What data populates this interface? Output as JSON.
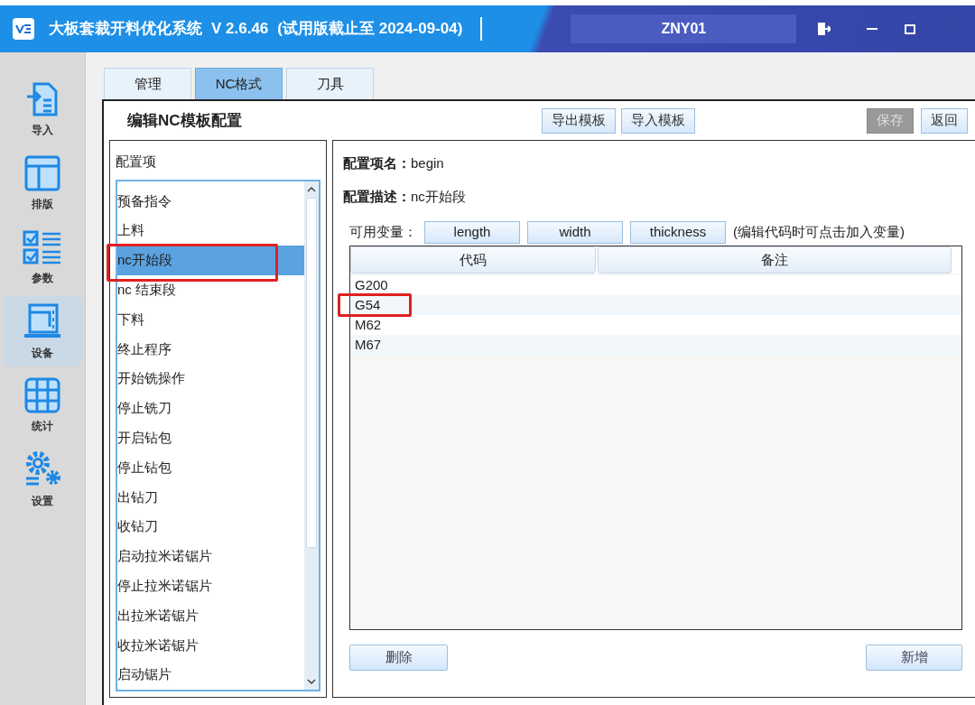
{
  "window": {
    "title": "大板套裁开料优化系统",
    "version": "V 2.6.46",
    "trial": "(试用版截止至 2024-09-04)",
    "user": "ZNY01"
  },
  "sidebar": {
    "items": [
      {
        "label": "导入",
        "selected": false
      },
      {
        "label": "排版",
        "selected": false
      },
      {
        "label": "参数",
        "selected": false
      },
      {
        "label": "设备",
        "selected": true
      },
      {
        "label": "统计",
        "selected": false
      },
      {
        "label": "设置",
        "selected": false
      }
    ]
  },
  "tabs": [
    {
      "label": "管理",
      "selected": false
    },
    {
      "label": "NC格式",
      "selected": true
    },
    {
      "label": "刀具",
      "selected": false
    }
  ],
  "editor": {
    "title": "编辑NC模板配置",
    "buttons": [
      {
        "label": "导出模板",
        "disabled": false
      },
      {
        "label": "导入模板",
        "disabled": false
      },
      {
        "label": "保存",
        "disabled": true
      },
      {
        "label": "返回",
        "disabled": false
      }
    ]
  },
  "config_list": {
    "heading": "配置项",
    "items": [
      {
        "label": "预备指令",
        "selected": false,
        "highlighted": false
      },
      {
        "label": "上料",
        "selected": false,
        "highlighted": false
      },
      {
        "label": "nc开始段",
        "selected": true,
        "highlighted": true
      },
      {
        "label": "nc 结束段",
        "selected": false,
        "highlighted": false
      },
      {
        "label": "下料",
        "selected": false,
        "highlighted": false
      },
      {
        "label": "终止程序",
        "selected": false,
        "highlighted": false
      },
      {
        "label": "开始铣操作",
        "selected": false,
        "highlighted": false
      },
      {
        "label": "停止铣刀",
        "selected": false,
        "highlighted": false
      },
      {
        "label": "开启钻包",
        "selected": false,
        "highlighted": false
      },
      {
        "label": "停止钻包",
        "selected": false,
        "highlighted": false
      },
      {
        "label": "出钻刀",
        "selected": false,
        "highlighted": false
      },
      {
        "label": "收钻刀",
        "selected": false,
        "highlighted": false
      },
      {
        "label": "启动拉米诺锯片",
        "selected": false,
        "highlighted": false
      },
      {
        "label": "停止拉米诺锯片",
        "selected": false,
        "highlighted": false
      },
      {
        "label": "出拉米诺锯片",
        "selected": false,
        "highlighted": false
      },
      {
        "label": "收拉米诺锯片",
        "selected": false,
        "highlighted": false
      },
      {
        "label": "启动锯片",
        "selected": false,
        "highlighted": false
      }
    ]
  },
  "detail": {
    "name_label": "配置项名：",
    "name_value": "begin",
    "desc_label": "配置描述：",
    "desc_value": "nc开始段",
    "variables_label": "可用变量：",
    "variables": [
      "length",
      "width",
      "thickness"
    ],
    "variables_hint": "(编辑代码时可点击加入变量)",
    "table": {
      "columns": [
        "代码",
        "备注"
      ],
      "rows": [
        {
          "code": "G200",
          "highlighted": false
        },
        {
          "code": "G54",
          "highlighted": true
        },
        {
          "code": "M62",
          "highlighted": false
        },
        {
          "code": "M67",
          "highlighted": false
        }
      ]
    },
    "delete_button": "删除",
    "add_button": "新增"
  }
}
